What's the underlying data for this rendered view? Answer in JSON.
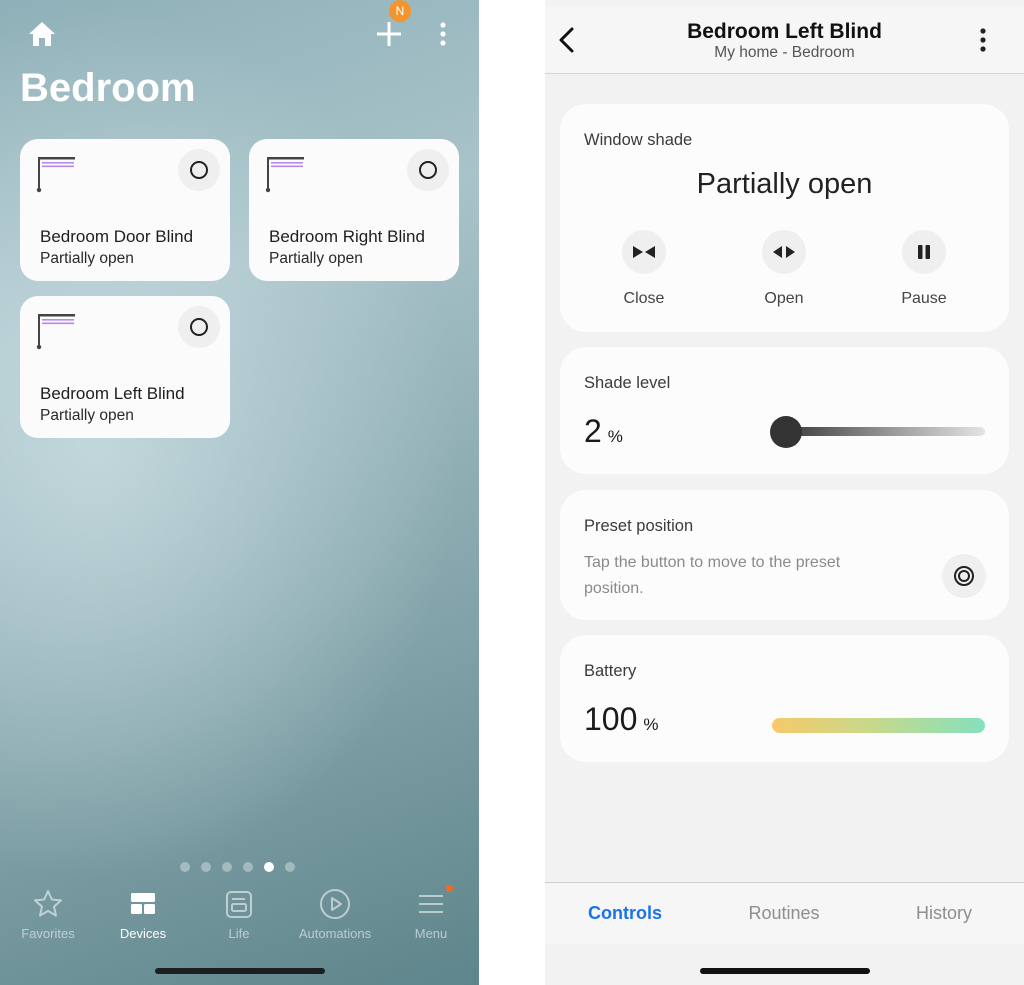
{
  "left_panel": {
    "header": {
      "home_icon": "home-icon",
      "add_icon": "plus-icon",
      "notification_badge": "N",
      "more_icon": "more-vertical-icon"
    },
    "room_title": "Bedroom",
    "devices": [
      {
        "name": "Bedroom Door Blind",
        "status": "Partially open",
        "icon": "blind-icon",
        "power_icon": "power-circle-icon"
      },
      {
        "name": "Bedroom Right Blind",
        "status": "Partially open",
        "icon": "blind-icon",
        "power_icon": "power-circle-icon"
      },
      {
        "name": "Bedroom Left Blind",
        "status": "Partially open",
        "icon": "blind-icon",
        "power_icon": "power-circle-icon"
      }
    ],
    "page_indicator": {
      "total": 6,
      "active_index": 4
    },
    "bottom_nav": [
      {
        "label": "Favorites",
        "icon": "star-icon",
        "active": false
      },
      {
        "label": "Devices",
        "icon": "devices-grid-icon",
        "active": true
      },
      {
        "label": "Life",
        "icon": "life-icon",
        "active": false
      },
      {
        "label": "Automations",
        "icon": "play-circle-icon",
        "active": false
      },
      {
        "label": "Menu",
        "icon": "menu-icon",
        "active": false,
        "has_dot": true
      }
    ],
    "colors": {
      "badge": "#f3942d",
      "menu_dot": "#f76a1c"
    }
  },
  "right_panel": {
    "header": {
      "title": "Bedroom Left Blind",
      "subtitle": "My home - Bedroom",
      "back_icon": "chevron-left-icon",
      "more_icon": "more-vertical-icon"
    },
    "window_shade": {
      "label": "Window shade",
      "state": "Partially open",
      "controls": [
        {
          "label": "Close",
          "icon": "close-shade-icon"
        },
        {
          "label": "Open",
          "icon": "open-shade-icon"
        },
        {
          "label": "Pause",
          "icon": "pause-icon"
        }
      ]
    },
    "shade_level": {
      "label": "Shade level",
      "value": "2",
      "unit": "%",
      "slider_percent": 2
    },
    "preset_position": {
      "label": "Preset position",
      "description": "Tap the button to move to the preset position.",
      "icon": "preset-target-icon"
    },
    "battery": {
      "label": "Battery",
      "value": "100",
      "unit": "%",
      "level_percent": 100
    },
    "tabs": [
      {
        "label": "Controls",
        "active": true
      },
      {
        "label": "Routines",
        "active": false
      },
      {
        "label": "History",
        "active": false
      }
    ],
    "colors": {
      "active_tab": "#1a73e8"
    }
  }
}
